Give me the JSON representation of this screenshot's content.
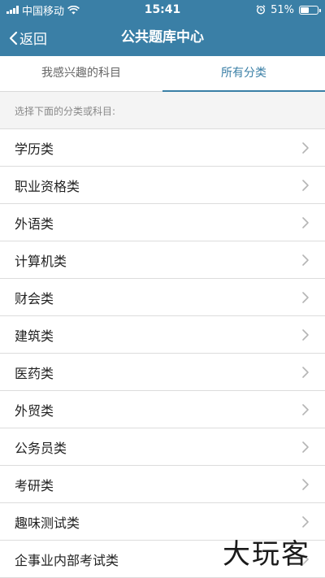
{
  "status_bar": {
    "carrier": "中国移动",
    "time": "15:41",
    "battery_percent": "51%",
    "battery_level": 0.51
  },
  "nav": {
    "back_label": "返回",
    "title": "公共题库中心"
  },
  "tabs": [
    {
      "label": "我感兴趣的科目",
      "active": false
    },
    {
      "label": "所有分类",
      "active": true
    }
  ],
  "hint": "选择下面的分类或科目:",
  "categories": [
    {
      "label": "学历类"
    },
    {
      "label": "职业资格类"
    },
    {
      "label": "外语类"
    },
    {
      "label": "计算机类"
    },
    {
      "label": "财会类"
    },
    {
      "label": "建筑类"
    },
    {
      "label": "医药类"
    },
    {
      "label": "外贸类"
    },
    {
      "label": "公务员类"
    },
    {
      "label": "考研类"
    },
    {
      "label": "趣味测试类"
    },
    {
      "label": "企事业内部考试类"
    }
  ],
  "watermark": "大玩客",
  "colors": {
    "accent": "#3a7fa6",
    "background": "#f4f4f4"
  }
}
